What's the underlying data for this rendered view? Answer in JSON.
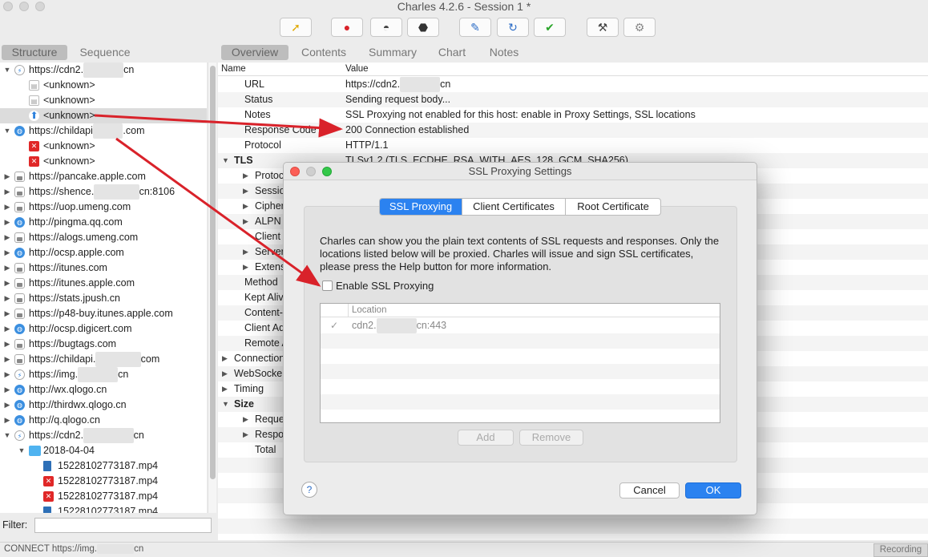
{
  "window": {
    "title": "Charles 4.2.6 - Session 1 *"
  },
  "toolbar": {
    "buttons": [
      {
        "icon": "broom-icon",
        "glyph": "🧹"
      },
      {
        "icon": "record-icon",
        "glyph": "●"
      },
      {
        "icon": "throttle-icon",
        "glyph": "🐢"
      },
      {
        "icon": "breakpoint-icon",
        "glyph": "⬣"
      },
      {
        "icon": "compose-icon",
        "glyph": "✎"
      },
      {
        "icon": "repeat-icon",
        "glyph": "↻"
      },
      {
        "icon": "validate-icon",
        "glyph": "✔"
      },
      {
        "icon": "tools-icon",
        "glyph": "⚒"
      },
      {
        "icon": "settings-icon",
        "glyph": "⚙"
      }
    ]
  },
  "left_tabs": {
    "structure": "Structure",
    "sequence": "Sequence"
  },
  "right_tabs": {
    "overview": "Overview",
    "contents": "Contents",
    "summary": "Summary",
    "chart": "Chart",
    "notes": "Notes"
  },
  "tree": [
    {
      "label": "https://cdn2.",
      "mask": "xxxxxxxx",
      "tail": "cn",
      "icon": "bolt",
      "tri": "▼",
      "indent": 0
    },
    {
      "label": "<unknown>",
      "mask": "",
      "tail": "",
      "icon": "doc",
      "tri": "",
      "indent": 1
    },
    {
      "label": "<unknown>",
      "mask": "",
      "tail": "",
      "icon": "doc",
      "tri": "",
      "indent": 1
    },
    {
      "label": "<unknown>",
      "mask": "",
      "tail": "",
      "icon": "up",
      "tri": "",
      "indent": 1,
      "selected": true
    },
    {
      "label": "https://childapi",
      "mask": "xxxxxx",
      "tail": ".com",
      "icon": "globe",
      "tri": "▼",
      "indent": 0
    },
    {
      "label": "<unknown>",
      "mask": "",
      "tail": "",
      "icon": "err",
      "tri": "",
      "indent": 1
    },
    {
      "label": "<unknown>",
      "mask": "",
      "tail": "",
      "icon": "err",
      "tri": "",
      "indent": 1
    },
    {
      "label": "https://pancake.apple.com",
      "mask": "",
      "tail": "",
      "icon": "lock",
      "tri": "▶",
      "indent": 0
    },
    {
      "label": "https://shence.",
      "mask": "xxxxxxxxx",
      "tail": "cn:8106",
      "icon": "lock",
      "tri": "▶",
      "indent": 0
    },
    {
      "label": "https://uop.umeng.com",
      "mask": "",
      "tail": "",
      "icon": "lock",
      "tri": "▶",
      "indent": 0
    },
    {
      "label": "http://pingma.qq.com",
      "mask": "",
      "tail": "",
      "icon": "globe",
      "tri": "▶",
      "indent": 0
    },
    {
      "label": "https://alogs.umeng.com",
      "mask": "",
      "tail": "",
      "icon": "lock",
      "tri": "▶",
      "indent": 0
    },
    {
      "label": "http://ocsp.apple.com",
      "mask": "",
      "tail": "",
      "icon": "globe",
      "tri": "▶",
      "indent": 0
    },
    {
      "label": "https://itunes.com",
      "mask": "",
      "tail": "",
      "icon": "lock",
      "tri": "▶",
      "indent": 0
    },
    {
      "label": "https://itunes.apple.com",
      "mask": "",
      "tail": "",
      "icon": "lock",
      "tri": "▶",
      "indent": 0
    },
    {
      "label": "https://stats.jpush.cn",
      "mask": "",
      "tail": "",
      "icon": "lock",
      "tri": "▶",
      "indent": 0
    },
    {
      "label": "https://p48-buy.itunes.apple.com",
      "mask": "",
      "tail": "",
      "icon": "lock",
      "tri": "▶",
      "indent": 0
    },
    {
      "label": "http://ocsp.digicert.com",
      "mask": "",
      "tail": "",
      "icon": "globe",
      "tri": "▶",
      "indent": 0
    },
    {
      "label": "https://bugtags.com",
      "mask": "",
      "tail": "",
      "icon": "lock",
      "tri": "▶",
      "indent": 0
    },
    {
      "label": "https://childapi.",
      "mask": "xxxxxxxxx",
      "tail": "com",
      "icon": "lock",
      "tri": "▶",
      "indent": 0
    },
    {
      "label": "https://img.",
      "mask": "xxxxxxxx",
      "tail": "cn",
      "icon": "bolt",
      "tri": "▶",
      "indent": 0
    },
    {
      "label": "http://wx.qlogo.cn",
      "mask": "",
      "tail": "",
      "icon": "globe",
      "tri": "▶",
      "indent": 0
    },
    {
      "label": "http://thirdwx.qlogo.cn",
      "mask": "",
      "tail": "",
      "icon": "globe",
      "tri": "▶",
      "indent": 0
    },
    {
      "label": "http://q.qlogo.cn",
      "mask": "",
      "tail": "",
      "icon": "globe",
      "tri": "▶",
      "indent": 0
    },
    {
      "label": "https://cdn2.",
      "mask": "xxxxxxxxxx",
      "tail": "cn",
      "icon": "bolt",
      "tri": "▼",
      "indent": 0
    },
    {
      "label": "2018-04-04",
      "mask": "",
      "tail": "",
      "icon": "folder",
      "tri": "▼",
      "indent": 1
    },
    {
      "label": "15228102773187.mp4",
      "mask": "",
      "tail": "",
      "icon": "film",
      "tri": "",
      "indent": 2
    },
    {
      "label": "15228102773187.mp4",
      "mask": "",
      "tail": "",
      "icon": "err",
      "tri": "",
      "indent": 2
    },
    {
      "label": "15228102773187.mp4",
      "mask": "",
      "tail": "",
      "icon": "err",
      "tri": "",
      "indent": 2
    },
    {
      "label": "15228102773187.mp4",
      "mask": "",
      "tail": "",
      "icon": "film",
      "tri": "",
      "indent": 2
    }
  ],
  "filter": {
    "label": "Filter:",
    "value": ""
  },
  "status": {
    "text_prefix": "CONNECT https://img.",
    "mask": "xxxxxxxx",
    "text_suffix": "cn",
    "recording": "Recording"
  },
  "detail": {
    "header": {
      "name": "Name",
      "value": "Value"
    },
    "rows": [
      {
        "name": "URL",
        "value": "https://cdn2.",
        "mask": "xxxxxxxx",
        "tail": "cn",
        "tri": "",
        "indent": 1
      },
      {
        "name": "Status",
        "value": "Sending request body...",
        "tri": "",
        "indent": 1
      },
      {
        "name": "Notes",
        "value": "SSL Proxying not enabled for this host: enable in Proxy Settings, SSL locations",
        "tri": "",
        "indent": 1
      },
      {
        "name": "Response Code",
        "value": "200 Connection established",
        "tri": "",
        "indent": 1
      },
      {
        "name": "Protocol",
        "value": "HTTP/1.1",
        "tri": "",
        "indent": 1
      },
      {
        "name": "TLS",
        "value": "TLSv1.2 (TLS_ECDHE_RSA_WITH_AES_128_GCM_SHA256)",
        "tri": "▼",
        "indent": 0,
        "bold": true
      },
      {
        "name": "Protocol",
        "value": "",
        "tri": "▶",
        "indent": 2
      },
      {
        "name": "Session",
        "value": "",
        "tri": "▶",
        "indent": 2
      },
      {
        "name": "Cipher",
        "value": "",
        "tri": "▶",
        "indent": 2
      },
      {
        "name": "ALPN",
        "value": "",
        "tri": "▶",
        "indent": 2
      },
      {
        "name": "Client C",
        "value": "",
        "tri": "",
        "indent": 2
      },
      {
        "name": "Server",
        "value": "",
        "tri": "▶",
        "indent": 2
      },
      {
        "name": "Extensio",
        "value": "",
        "tri": "▶",
        "indent": 2
      },
      {
        "name": "Method",
        "value": "",
        "tri": "",
        "indent": 1
      },
      {
        "name": "Kept Alive",
        "value": "",
        "tri": "",
        "indent": 1
      },
      {
        "name": "Content-Ty",
        "value": "",
        "tri": "",
        "indent": 1
      },
      {
        "name": "Client Addr",
        "value": "",
        "tri": "",
        "indent": 1
      },
      {
        "name": "Remote Ad",
        "value": "",
        "tri": "",
        "indent": 1
      },
      {
        "name": "Connection",
        "value": "",
        "tri": "▶",
        "indent": 0
      },
      {
        "name": "WebSocke",
        "value": "",
        "tri": "▶",
        "indent": 0
      },
      {
        "name": "Timing",
        "value": "",
        "tri": "▶",
        "indent": 0
      },
      {
        "name": "Size",
        "value": "",
        "tri": "▼",
        "indent": 0,
        "bold": true
      },
      {
        "name": "Reques",
        "value": "",
        "tri": "▶",
        "indent": 2
      },
      {
        "name": "Respon",
        "value": "",
        "tri": "▶",
        "indent": 2
      },
      {
        "name": "Total",
        "value": "",
        "tri": "",
        "indent": 2
      }
    ]
  },
  "dialog": {
    "title": "SSL Proxying Settings",
    "tabs": [
      "SSL Proxying",
      "Client Certificates",
      "Root Certificate"
    ],
    "description": "Charles can show you the plain text contents of SSL requests and responses. Only the locations listed below will be proxied. Charles will issue and sign SSL certificates, please press the Help button for more information.",
    "enable_label": "Enable SSL Proxying",
    "table_header": "Location",
    "locations": [
      {
        "prefix": "cdn2.",
        "mask": "xxxxxxxx",
        "suffix": "cn:443",
        "checked": true
      }
    ],
    "add": "Add",
    "remove": "Remove",
    "help": "?",
    "cancel": "Cancel",
    "ok": "OK"
  },
  "colors": {
    "accent": "#2b82f0",
    "arrow": "#d9222a"
  }
}
